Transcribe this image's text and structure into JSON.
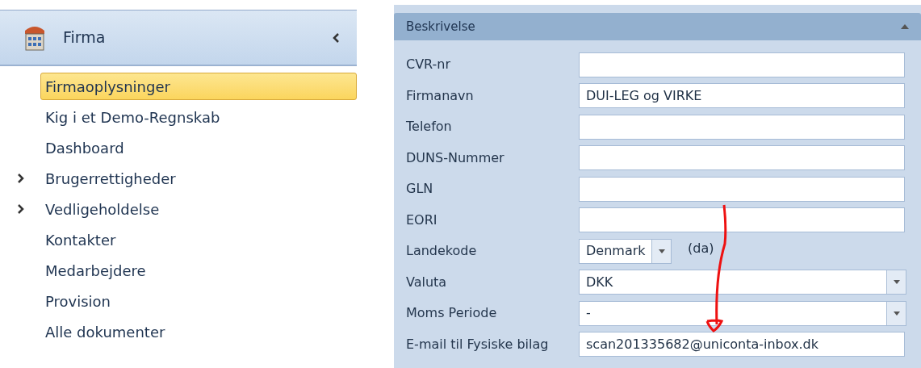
{
  "sidebar": {
    "title": "Firma",
    "items": [
      {
        "label": "Firmaoplysninger",
        "selected": true
      },
      {
        "label": "Kig i et Demo-Regnskab",
        "selected": false
      },
      {
        "label": "Dashboard",
        "selected": false
      },
      {
        "label": "Brugerrettigheder",
        "selected": false,
        "expanded": false
      },
      {
        "label": "Vedligeholdelse",
        "selected": false,
        "expanded": false
      },
      {
        "label": "Kontakter",
        "selected": false
      },
      {
        "label": "Medarbejdere",
        "selected": false
      },
      {
        "label": "Provision",
        "selected": false
      },
      {
        "label": "Alle dokumenter",
        "selected": false
      }
    ]
  },
  "form": {
    "title": "Beskrivelse",
    "expanded": true,
    "fields": [
      {
        "label": "CVR-nr",
        "kind": "text"
      },
      {
        "label": "Firmanavn",
        "kind": "text",
        "value": "DUI-LEG og VIRKE"
      },
      {
        "label": "Telefon",
        "kind": "text"
      },
      {
        "label": "DUNS-Nummer",
        "kind": "text"
      },
      {
        "label": "GLN",
        "kind": "text"
      },
      {
        "label": "EORI",
        "kind": "text"
      },
      {
        "label": "Landekode",
        "kind": "short-combo",
        "value": "Denmark",
        "suffix": "(da)"
      },
      {
        "label": "Valuta",
        "kind": "combo",
        "value": "DKK"
      },
      {
        "label": "Moms Periode",
        "kind": "combo",
        "value": "-"
      },
      {
        "label": "E-mail til Fysiske bilag",
        "kind": "text",
        "value": "scan201335682@uniconta-inbox.dk"
      }
    ]
  }
}
